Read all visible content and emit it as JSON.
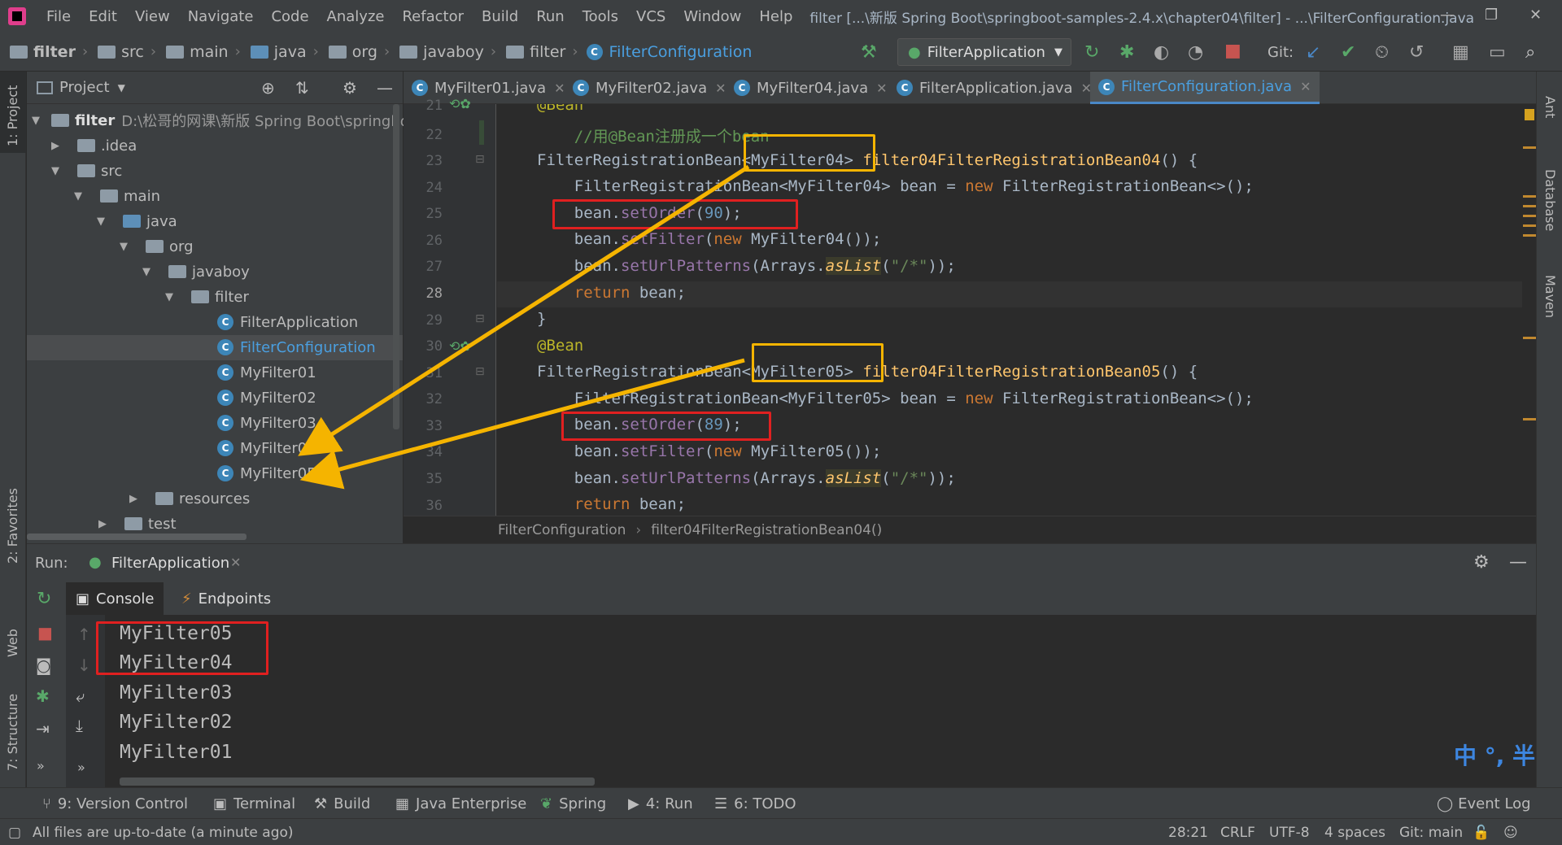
{
  "menu": {
    "items": [
      "File",
      "Edit",
      "View",
      "Navigate",
      "Code",
      "Analyze",
      "Refactor",
      "Build",
      "Run",
      "Tools",
      "VCS",
      "Window",
      "Help"
    ],
    "window_title": "filter [...\\新版 Spring Boot\\springboot-samples-2.4.x\\chapter04\\filter] - ...\\FilterConfiguration.java"
  },
  "nav": {
    "crumbs": [
      "filter",
      "src",
      "main",
      "java",
      "org",
      "javaboy",
      "filter",
      "FilterConfiguration"
    ],
    "run_config": "FilterApplication",
    "git_label": "Git:"
  },
  "project": {
    "header": "Project",
    "root_name": "filter",
    "root_path": "D:\\松哥的网课\\新版 Spring Boot\\springboot",
    "items": {
      "idea": ".idea",
      "src": "src",
      "main": "main",
      "java": "java",
      "org": "org",
      "javaboy": "javaboy",
      "filter": "filter",
      "f_app": "FilterApplication",
      "f_conf": "FilterConfiguration",
      "f1": "MyFilter01",
      "f2": "MyFilter02",
      "f3": "MyFilter03",
      "f4": "MyFilter04",
      "f5": "MyFilter05",
      "resources": "resources",
      "test": "test"
    }
  },
  "tabs": [
    "MyFilter01.java",
    "MyFilter02.java",
    "MyFilter04.java",
    "FilterApplication.java",
    "FilterConfiguration.java"
  ],
  "editor": {
    "line_numbers": [
      "21",
      "22",
      "23",
      "24",
      "25",
      "26",
      "27",
      "28",
      "29",
      "30",
      "31",
      "32",
      "33",
      "34",
      "35",
      "36"
    ],
    "breadcrumb_class": "FilterConfiguration",
    "breadcrumb_method": "filter04FilterRegistrationBean04()"
  },
  "run": {
    "label": "Run:",
    "config": "FilterApplication",
    "console_tab": "Console",
    "endpoints_tab": "Endpoints",
    "output": [
      "MyFilter05",
      "MyFilter04",
      "MyFilter03",
      "MyFilter02",
      "MyFilter01"
    ]
  },
  "bottom_tabs": {
    "vc": "9: Version Control",
    "terminal": "Terminal",
    "build": "Build",
    "jee": "Java Enterprise",
    "spring": "Spring",
    "run": "4: Run",
    "todo": "6: TODO",
    "event_log": "Event Log"
  },
  "status": {
    "message": "All files are up-to-date (a minute ago)",
    "position": "28:21",
    "line_sep": "CRLF",
    "encoding": "UTF-8",
    "indent": "4 spaces",
    "git": "Git: main"
  },
  "side": {
    "left_project": "1: Project",
    "left_favorites": "2: Favorites",
    "left_web": "Web",
    "left_structure": "7: Structure",
    "right_ant": "Ant",
    "right_database": "Database",
    "right_maven": "Maven"
  },
  "ime": "中 °, 半"
}
